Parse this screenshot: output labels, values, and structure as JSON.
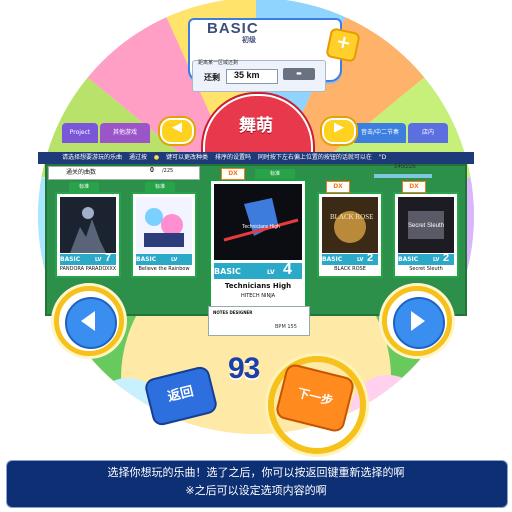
{
  "header": {
    "mode": "BASIC",
    "mode_sub": "初级",
    "plus_label": "+"
  },
  "distance": {
    "tip": "距离某一区域还剩",
    "label": "还剩",
    "value": "35 km"
  },
  "genre": {
    "title": "舞萌",
    "prev_icon": "triangle-left-icon",
    "next_icon": "triangle-right-icon"
  },
  "categories": {
    "left_1": "Project",
    "left_2": "其他游戏",
    "right_1": "音击/中二节奏",
    "right_2": "店内"
  },
  "ticker": {
    "part1": "请选择想要游玩的乐曲",
    "part2": "通过按",
    "part3": "键可以更改种类",
    "part4": "排序的设置吗",
    "part5": "同时按下左右偏上位置的按钮的话就可以在",
    "part6": "\"D"
  },
  "counters": {
    "left_label": "通关的曲数",
    "left_value": "0",
    "left_total": "/225",
    "right_value": "145/226"
  },
  "songs": [
    {
      "category": "标准",
      "difficulty": "BASIC",
      "lv_label": "LV",
      "level": "7",
      "title": "PANDORA PARADOXXX",
      "dx": ""
    },
    {
      "category": "标准",
      "difficulty": "BASIC",
      "lv_label": "LV",
      "level": "",
      "title": "Believe the Rainbow",
      "dx": ""
    },
    {
      "category": "标准",
      "difficulty": "BASIC",
      "lv_label": "LV",
      "level": "4",
      "title": "Technicians High",
      "artist": "HITECH NINJA",
      "designer_label": "NOTES DESIGNER",
      "bpm": "BPM 155",
      "dx": "DX"
    },
    {
      "category": "",
      "difficulty": "BASIC",
      "lv_label": "LV",
      "level": "2",
      "title": "BLACK ROSE",
      "dx": "DX"
    },
    {
      "category": "",
      "difficulty": "BASIC",
      "lv_label": "LV",
      "level": "2",
      "title": "Secret Sleuth",
      "dx": "DX"
    }
  ],
  "timer": "93",
  "buttons": {
    "back": "返回",
    "next": "下一步"
  },
  "caption": {
    "line1": "选择你想玩的乐曲！选了之后，你可以按返回键重新选择的啊",
    "line2": "※之后可以设定选项内容的啊"
  },
  "colors": {
    "panel_green": "#2c8f4a",
    "ticker_navy": "#1e3a78",
    "genre_red": "#e8384c",
    "arrow_blue": "#3a8ef0",
    "ring_yellow": "#f5c11a",
    "next_orange": "#ff8a1d",
    "back_blue": "#2e6fe0",
    "caption_navy": "#0d2f74"
  }
}
